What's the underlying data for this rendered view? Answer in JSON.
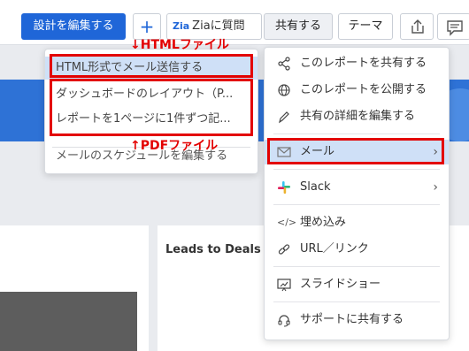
{
  "toolbar": {
    "edit_label": "設計を編集する",
    "add_label": "+",
    "zia_logo": "Zia",
    "zia_label": "Ziaに質問",
    "share_label": "共有する",
    "theme_label": "テーマ"
  },
  "dashboard": {
    "card_title": "Leads to Deals Co"
  },
  "email_submenu": {
    "items": [
      {
        "label": "HTML形式でメール送信する"
      },
      {
        "label": "ダッシュボードのレイアウト（P..."
      },
      {
        "label": "レポートを1ページに1件ずつ記..."
      },
      {
        "label": "メールのスケジュールを編集する"
      }
    ]
  },
  "share_menu": {
    "items": [
      {
        "label": "このレポートを共有する",
        "icon": "share-icon"
      },
      {
        "label": "このレポートを公開する",
        "icon": "globe-icon"
      },
      {
        "label": "共有の詳細を編集する",
        "icon": "pencil-icon"
      },
      {
        "label": "メール",
        "icon": "mail-icon"
      },
      {
        "label": "Slack",
        "icon": "slack-icon"
      },
      {
        "label": "埋め込み",
        "icon": "embed-icon"
      },
      {
        "label": "URL／リンク",
        "icon": "link-icon"
      },
      {
        "label": "スライドショー",
        "icon": "slideshow-icon"
      },
      {
        "label": "サポートに共有する",
        "icon": "support-icon"
      }
    ]
  },
  "annotations": {
    "html_label": "↓HTMLファイル",
    "pdf_label": "↑PDFファイル"
  },
  "colors": {
    "accent": "#1f66d8",
    "highlight": "#cfe0f7",
    "annotation": "#e30000"
  }
}
